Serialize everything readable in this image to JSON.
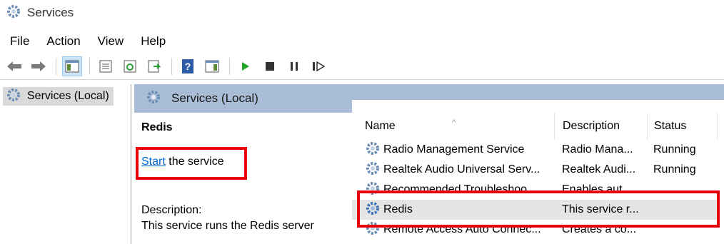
{
  "window": {
    "title": "Services",
    "icon": "gear-icon"
  },
  "menu": [
    "File",
    "Action",
    "View",
    "Help"
  ],
  "toolbar": {
    "buttons": [
      "back-arrow-icon",
      "forward-arrow-icon",
      "console-tree-icon",
      "properties-icon",
      "refresh-icon",
      "export-list-icon",
      "help-icon",
      "show-hide-action-pane-icon",
      "start-icon",
      "stop-icon",
      "pause-icon",
      "restart-icon"
    ],
    "play_color": "#22a62a"
  },
  "tree": {
    "item": "Services (Local)"
  },
  "pane": {
    "header": "Services (Local)",
    "selected_service": "Redis",
    "start_link": "Start",
    "start_suffix": " the service",
    "description_label": "Description:",
    "description_text": "This service runs the Redis server"
  },
  "list": {
    "columns": [
      "Name",
      "Description",
      "Status"
    ],
    "rows": [
      {
        "name": "Radio Management Service",
        "description": "Radio Mana...",
        "status": "Running"
      },
      {
        "name": "Realtek Audio Universal Serv...",
        "description": "Realtek Audi...",
        "status": "Running"
      },
      {
        "name": "Recommended Troubleshoo...",
        "description": "Enables aut...",
        "status": ""
      },
      {
        "name": "Redis",
        "description": "This service r...",
        "status": "",
        "selected": true
      },
      {
        "name": "Remote Access Auto Connec...",
        "description": "Creates a co...",
        "status": ""
      }
    ]
  },
  "highlight_color": "#e8000b"
}
